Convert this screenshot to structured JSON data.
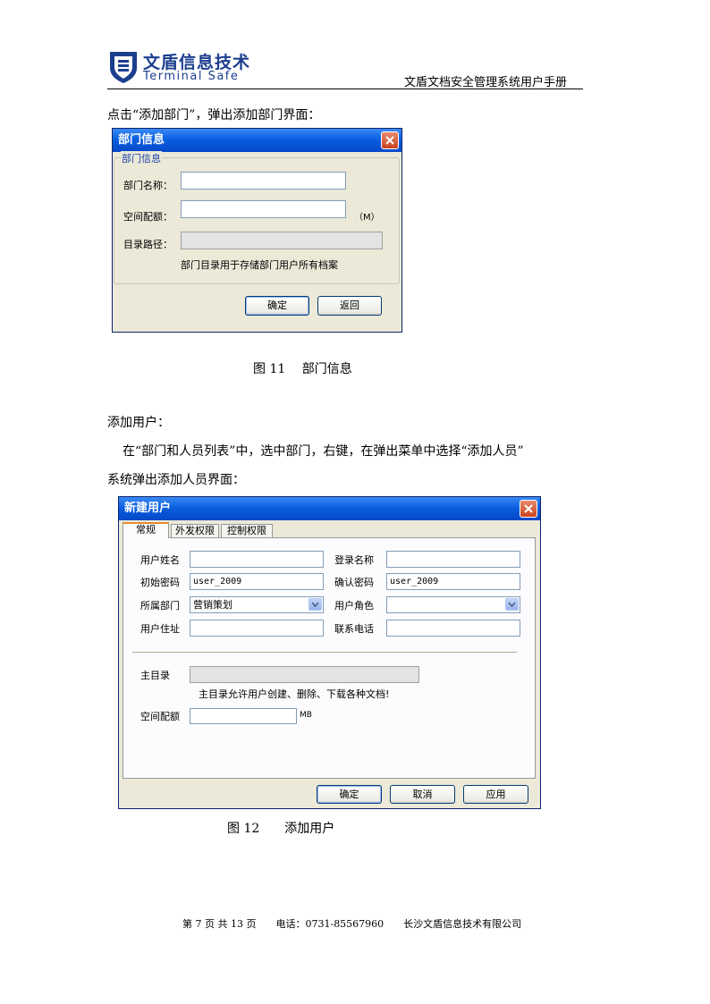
{
  "header": {
    "logo_cn": "文盾信息技术",
    "logo_en": "Terminal Safe",
    "doc_title": "文盾文档安全管理系统用户手册"
  },
  "para1": "点击“添加部门”，弹出添加部门界面：",
  "dept_dialog": {
    "title": "部门信息",
    "group_title": "部门信息",
    "name_label": "部门名称：",
    "name_value": "",
    "quota_label": "空间配额：",
    "quota_value": "",
    "quota_unit": "（M）",
    "path_label": "目录路径：",
    "path_value": "",
    "hint": "部门目录用于存储部门用户所有档案",
    "ok": "确定",
    "back": "返回"
  },
  "fig11": "图 11　 部门信息",
  "para2": "添加用户：",
  "para3": "在“部门和人员列表”中，选中部门，右键，在弹出菜单中选择“添加人员”",
  "para4": "系统弹出添加人员界面：",
  "user_dialog": {
    "title": "新建用户",
    "tabs": [
      "常规",
      "外发权限",
      "控制权限"
    ],
    "user_name_label": "用户姓名",
    "user_name_value": "",
    "login_name_label": "登录名称",
    "login_name_value": "",
    "init_pwd_label": "初始密码",
    "init_pwd_value": "user_2009",
    "confirm_pwd_label": "确认密码",
    "confirm_pwd_value": "user_2009",
    "dept_label": "所属部门",
    "dept_value": "营销策划",
    "role_label": "用户角色",
    "role_value": "",
    "address_label": "用户住址",
    "address_value": "",
    "phone_label": "联系电话",
    "phone_value": "",
    "home_dir_label": "主目录",
    "home_dir_value": "",
    "home_dir_hint": "主目录允许用户创建、删除、下载各种文档!",
    "quota_label": "空间配额",
    "quota_value": "",
    "quota_unit": "MB",
    "ok": "确定",
    "cancel": "取消",
    "apply": "应用"
  },
  "fig12": "图 12　　添加用户",
  "footer": "第 7 页 共 13 页　　电话：0731-85567960　　长沙文盾信息技术有限公司",
  "colors": {
    "brand": "#1b3e8f",
    "titlebar": "#0a5fe0",
    "dialog_bg": "#ece9d8"
  }
}
